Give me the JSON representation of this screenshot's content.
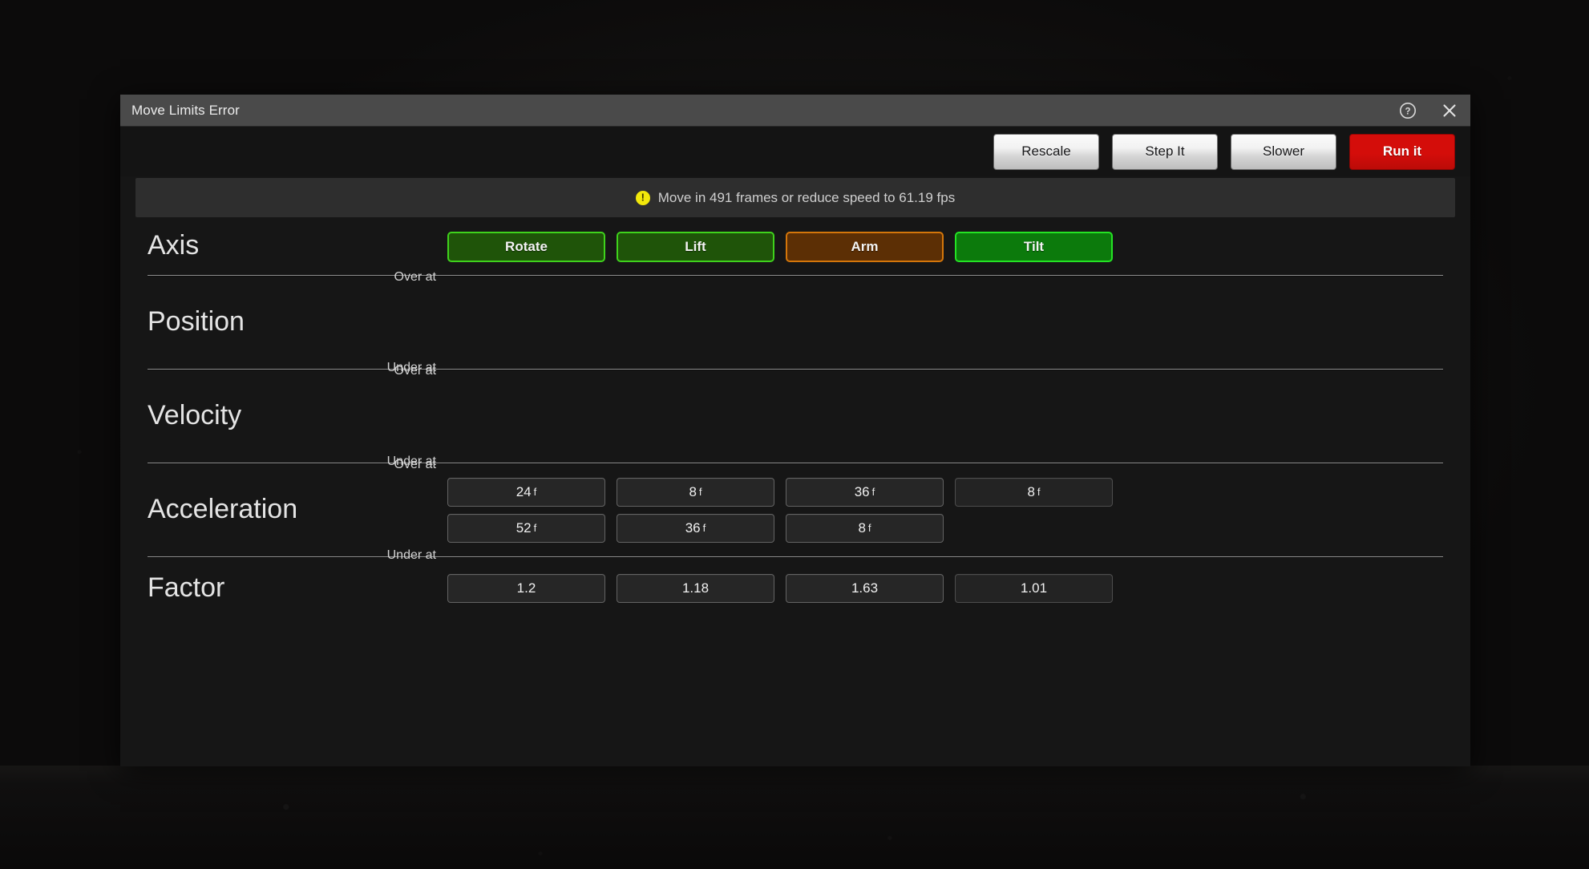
{
  "window": {
    "title": "Move Limits Error",
    "help_icon": "help-circle-icon",
    "close_icon": "close-icon"
  },
  "toolbar": {
    "buttons": [
      {
        "label": "Rescale",
        "style": "light"
      },
      {
        "label": "Step It",
        "style": "light"
      },
      {
        "label": "Slower",
        "style": "light"
      },
      {
        "label": "Run it",
        "style": "danger",
        "color": "#d40d0a"
      }
    ]
  },
  "message": {
    "icon": "warning-icon",
    "icon_color": "#f2e80b",
    "glyph": "!",
    "text": "Move in 491 frames or reduce speed to 61.19 fps"
  },
  "rows": {
    "axis": {
      "title": "Axis",
      "buttons": [
        {
          "label": "Rotate",
          "fill": "#1f5409",
          "border": "#3fd21c"
        },
        {
          "label": "Lift",
          "fill": "#1f5409",
          "border": "#3fd21c"
        },
        {
          "label": "Arm",
          "fill": "#5c2f05",
          "border": "#d4760a"
        },
        {
          "label": "Tilt",
          "fill": "#0c7a0c",
          "border": "#24e324"
        }
      ]
    },
    "position": {
      "title": "Position",
      "over_label": "Over at",
      "under_label": "Under at",
      "over_values": [
        "",
        "",
        "",
        ""
      ],
      "under_values": [
        "",
        "",
        "",
        ""
      ]
    },
    "velocity": {
      "title": "Velocity",
      "over_label": "Over at",
      "under_label": "Under at",
      "over_values": [
        "",
        "",
        "",
        ""
      ],
      "under_values": [
        "",
        "",
        "",
        ""
      ]
    },
    "acceleration": {
      "title": "Acceleration",
      "over_label": "Over at",
      "under_label": "Under at",
      "over_values": [
        "24",
        "8",
        "36",
        "8"
      ],
      "over_units": [
        "f",
        "f",
        "f",
        "f"
      ],
      "under_values": [
        "52",
        "36",
        "8",
        ""
      ],
      "under_units": [
        "f",
        "f",
        "f",
        ""
      ]
    },
    "factor": {
      "title": "Factor",
      "values": [
        "1.2",
        "1.18",
        "1.63",
        "1.01"
      ]
    }
  }
}
